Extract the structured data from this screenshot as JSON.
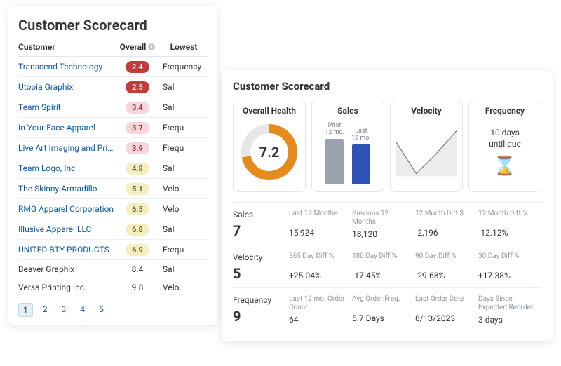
{
  "left": {
    "title": "Customer Scorecard",
    "headers": {
      "customer": "Customer",
      "overall": "Overall",
      "lowest": "Lowest"
    },
    "rows": [
      {
        "name": "Transcend Technology",
        "score": "2.4",
        "tone": "red",
        "lowest": "Frequency",
        "link": true
      },
      {
        "name": "Utopia Graphix",
        "score": "2.5",
        "tone": "red",
        "lowest": "Sal",
        "link": true
      },
      {
        "name": "Team Spirit",
        "score": "3.4",
        "tone": "pink",
        "lowest": "Sal",
        "link": true
      },
      {
        "name": "In Your Face Apparel",
        "score": "3.7",
        "tone": "pink",
        "lowest": "Frequ",
        "link": true
      },
      {
        "name": "Live Art Imaging and Print...",
        "score": "3.9",
        "tone": "pink",
        "lowest": "Frequ",
        "link": true
      },
      {
        "name": "Team Logo, Inc",
        "score": "4.8",
        "tone": "yellow",
        "lowest": "Sal",
        "link": true
      },
      {
        "name": "The Skinny Armadillo",
        "score": "5.1",
        "tone": "yellow",
        "lowest": "Velo",
        "link": true
      },
      {
        "name": "RMG Apparel Corporation",
        "score": "6.5",
        "tone": "yellow",
        "lowest": "Velo",
        "link": true
      },
      {
        "name": "Illusive Apparel LLC",
        "score": "6.8",
        "tone": "yellow",
        "lowest": "Sal",
        "link": true
      },
      {
        "name": "UNITED BTY PRODUCTS",
        "score": "6.9",
        "tone": "yellow",
        "lowest": "Frequ",
        "link": true
      },
      {
        "name": "Beaver Graphix",
        "score": "8.4",
        "tone": "plain",
        "lowest": "Sal",
        "link": false
      },
      {
        "name": "Versa Printing Inc.",
        "score": "9.8",
        "tone": "plain",
        "lowest": "Velo",
        "link": false
      }
    ],
    "pages": [
      "1",
      "2",
      "3",
      "4",
      "5"
    ],
    "active_page": 0
  },
  "right": {
    "title": "Customer Scorecard",
    "tiles": {
      "overall": {
        "title": "Overall Health",
        "score": "7.2"
      },
      "sales": {
        "title": "Sales",
        "prior_label": "Prior\n12 mo.",
        "last_label": "Last\n12 mo."
      },
      "velocity": {
        "title": "Velocity"
      },
      "frequency": {
        "title": "Frequency",
        "text": "10 days\nuntil due"
      }
    },
    "metrics": {
      "sales": {
        "title": "Sales",
        "score": "7",
        "cells": [
          {
            "label": "Last 12 Months",
            "value": "15,924"
          },
          {
            "label": "Previous 12 Months",
            "value": "18,120"
          },
          {
            "label": "12 Month Diff $",
            "value": "-2,196"
          },
          {
            "label": "12 Month Diff %",
            "value": "-12.12%"
          }
        ]
      },
      "velocity": {
        "title": "Velocity",
        "score": "5",
        "cells": [
          {
            "label": "365 Day Diff %",
            "value": "+25.04%"
          },
          {
            "label": "180 Day Diff %",
            "value": "-17.45%"
          },
          {
            "label": "90 Day Diff %",
            "value": "-29.68%"
          },
          {
            "label": "30 Day Diff %",
            "value": "+17.38%"
          }
        ]
      },
      "frequency": {
        "title": "Frequency",
        "score": "9",
        "cells": [
          {
            "label": "Last 12 mo. Order Count",
            "value": "64"
          },
          {
            "label": "Avg Order Freq.",
            "value": "5.7 Days"
          },
          {
            "label": "Last Order Date",
            "value": "8/13/2023"
          },
          {
            "label": "Days Since Expected Reorder",
            "value": "3 days"
          }
        ]
      }
    }
  },
  "chart_data": [
    {
      "type": "pie",
      "title": "Overall Health",
      "slices": [
        {
          "name": "score",
          "value": 7.2,
          "color": "#e78a1e"
        },
        {
          "name": "remaining",
          "value": 2.8,
          "color": "#e6e6e6"
        }
      ],
      "max": 10
    },
    {
      "type": "bar",
      "title": "Sales",
      "categories": [
        "Prior 12 mo.",
        "Last 12 mo."
      ],
      "values": [
        18120,
        15924
      ],
      "colors": [
        "#9aa2ad",
        "#2f54b8"
      ]
    },
    {
      "type": "line",
      "title": "Velocity",
      "x": [
        0,
        1,
        2,
        3
      ],
      "values": [
        0.7,
        0.05,
        0.45,
        0.95
      ],
      "ylim": [
        0,
        1
      ]
    }
  ]
}
